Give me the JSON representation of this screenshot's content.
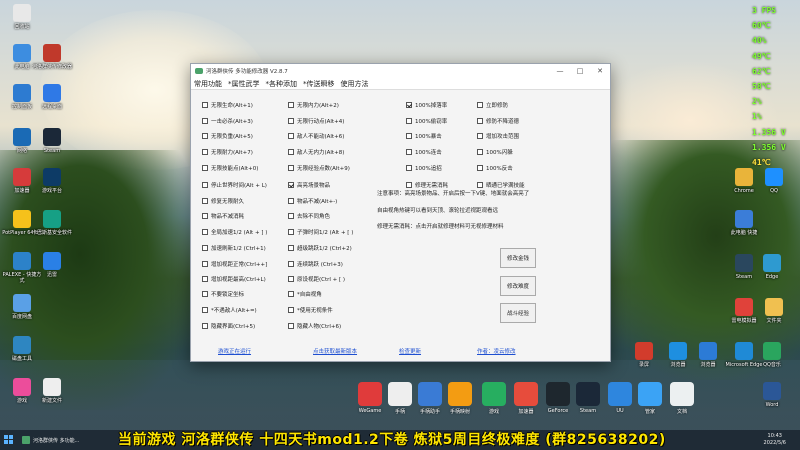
{
  "desktop_icons_left": [
    {
      "label": "回收站",
      "color": "#e8e8e8"
    },
    {
      "label": "此电脑",
      "color": "#3d8de0"
    },
    {
      "label": "河洛群侠传修改器",
      "color": "#c0392b"
    },
    {
      "label": "控制面板",
      "color": "#2d7bd1"
    },
    {
      "label": "远程桌面",
      "color": "#2f79e6"
    },
    {
      "label": "网络",
      "color": "#1a6ab5"
    },
    {
      "label": "Steam",
      "color": "#1b2838"
    },
    {
      "label": "游戏平台",
      "color": "#0d3b66"
    },
    {
      "label": "加速器",
      "color": "#d63b3b"
    },
    {
      "label": "PotPlayer 64 bit",
      "color": "#f5c11b"
    },
    {
      "label": "卡巴斯基安全软件",
      "color": "#16a085"
    },
    {
      "label": "PALEXE - 快捷方式",
      "color": "#2c82c9"
    },
    {
      "label": "迅雷",
      "color": "#2a80e6"
    },
    {
      "label": "百度网盘",
      "color": "#5aa0e6"
    },
    {
      "label": "磁盘工具",
      "color": "#2e86c1"
    },
    {
      "label": "游戏",
      "color": "#ec4d9b"
    },
    {
      "label": "新建文件",
      "color": "#eeeeee"
    }
  ],
  "hud": [
    {
      "text": "3 FPS",
      "yellow": false
    },
    {
      "text": "60℃",
      "yellow": false
    },
    {
      "text": "40%",
      "yellow": false
    },
    {
      "text": "49℃",
      "yellow": false
    },
    {
      "text": "62℃",
      "yellow": false
    },
    {
      "text": "58℃",
      "yellow": false
    },
    {
      "text": "2%",
      "yellow": false
    },
    {
      "text": "1%",
      "yellow": false
    },
    {
      "text": "1.356 V",
      "yellow": false
    },
    {
      "text": "1.356 V",
      "yellow": false
    },
    {
      "text": "41℃",
      "yellow": true
    }
  ],
  "window": {
    "title": "河洛群侠传 多功能修改器  V2.8.7",
    "minimize": "—",
    "maximize": "□",
    "close": "✕",
    "menus": [
      "常用功能",
      "*属性武学",
      "*各种添加",
      "*传送瞬移",
      "使用方法"
    ],
    "col1": [
      {
        "label": "无限生命(Alt+1)",
        "checked": false
      },
      {
        "label": "一击必杀(Alt+3)",
        "checked": false
      },
      {
        "label": "无限负重(Alt+5)",
        "checked": false
      },
      {
        "label": "无限耐力(Alt+7)",
        "checked": false
      },
      {
        "label": "无限技能点(Alt+0)",
        "checked": false
      },
      {
        "label": "停止世界时间(Alt + L)",
        "checked": false
      },
      {
        "label": "修复无限耐久",
        "checked": false
      },
      {
        "label": "物品不减消耗",
        "checked": false
      },
      {
        "label": "全局加速1/2 (Alt + ] )",
        "checked": false
      },
      {
        "label": "加速刷新1/2 (Ctrl+1)",
        "checked": false
      },
      {
        "label": "增加视距正常(Ctrl++]",
        "checked": false
      },
      {
        "label": "增加视距最高(Ctrl+L)",
        "checked": false
      },
      {
        "label": "不要锁定坐标",
        "checked": false
      },
      {
        "label": "*不遇敌人(Alt+=)",
        "checked": false
      },
      {
        "label": "隐藏界面(Ctrl+5)",
        "checked": false
      }
    ],
    "col2": [
      {
        "label": "无限内力(Alt+2)",
        "checked": false
      },
      {
        "label": "无限行动点(Alt+4)",
        "checked": false
      },
      {
        "label": "敌人不能动(Alt+6)",
        "checked": false
      },
      {
        "label": "敌人无内力(Alt+8)",
        "checked": false
      },
      {
        "label": "无限经验点数(Alt+9)",
        "checked": false
      },
      {
        "label": "高亮场景物品",
        "checked": true
      },
      {
        "label": "物品不减(Alt+-)",
        "checked": false
      },
      {
        "label": "去除不同角色",
        "checked": false
      },
      {
        "label": "子弹时间1/2 (Alt + [ )",
        "checked": false
      },
      {
        "label": "超级跳跃1/2 (Ctrl+2)",
        "checked": false
      },
      {
        "label": "连续跳跃 (Ctrl+3)",
        "checked": false
      },
      {
        "label": "原设视距(Ctrl + [ )",
        "checked": false
      },
      {
        "label": "*自由视角",
        "checked": false
      },
      {
        "label": "*使用无视条件",
        "checked": false
      },
      {
        "label": "隐藏人物(Ctrl+6)",
        "checked": false
      }
    ],
    "col3": [
      {
        "label": "100%掉落率",
        "checked": true
      },
      {
        "label": "100%偷窃率",
        "checked": false
      },
      {
        "label": "100%暴击",
        "checked": false
      },
      {
        "label": "100%连击",
        "checked": false
      },
      {
        "label": "100%追招",
        "checked": false
      },
      {
        "label": "修理无需消耗",
        "checked": false
      }
    ],
    "col4": [
      {
        "label": "立即修防",
        "checked": false
      },
      {
        "label": "修防不降道德",
        "checked": false
      },
      {
        "label": "增加攻击范围",
        "checked": false
      },
      {
        "label": "100%闪躲",
        "checked": false
      },
      {
        "label": "100%反击",
        "checked": false
      },
      {
        "label": "晒通已学满技能",
        "checked": false
      }
    ],
    "notes": [
      "注意事项：高亮场景物品、开启后按一下V键、地面就会高亮了",
      "自由视角热键可以看到天顶、滚轮拉近视距观看远",
      "修理无需消耗：点击开启就修理材料可无视修理材料"
    ],
    "buttons": [
      "修改金钱",
      "修改难度",
      "战斗经验"
    ],
    "links": [
      "游戏正在运行",
      "点击获取最新版本",
      "检查更新",
      "作者：凌云修改"
    ]
  },
  "right_icons": [
    {
      "label": "Chrome",
      "color": "#e9b43a"
    },
    {
      "label": "QQ",
      "color": "#1e90ff"
    },
    {
      "label": "此电脑 快捷",
      "color": "#3b7dd8"
    },
    {
      "label": "Steam",
      "color": "#2a475e"
    },
    {
      "label": "雷电模拟器",
      "color": "#e0423a"
    },
    {
      "label": "文件夹",
      "color": "#f0c050"
    },
    {
      "label": "Edge",
      "color": "#2e9ad0"
    },
    {
      "label": "录屏",
      "color": "#d23c2c"
    },
    {
      "label": "浏览器",
      "color": "#1e8fe0"
    },
    {
      "label": "浏览器",
      "color": "#2c7bd6"
    },
    {
      "label": "Microsoft Edge",
      "color": "#1f8ad6"
    },
    {
      "label": "QQ音乐",
      "color": "#2aa55e"
    },
    {
      "label": "Word",
      "color": "#2b5797"
    }
  ],
  "shelf": [
    {
      "label": "WeGame",
      "color": "#e03b3b"
    },
    {
      "label": "手柄",
      "color": "#eeeeee"
    },
    {
      "label": "手柄助手",
      "color": "#3a7bd5"
    },
    {
      "label": "手柄映射",
      "color": "#f39c12"
    },
    {
      "label": "游戏",
      "color": "#27ae60"
    },
    {
      "label": "加速器",
      "color": "#e74c3c"
    },
    {
      "label": "GeForce",
      "color": "#1e272e"
    },
    {
      "label": "Steam",
      "color": "#1b2838"
    },
    {
      "label": "UU",
      "color": "#2e86de"
    },
    {
      "label": "管家",
      "color": "#3ba3f5"
    },
    {
      "label": "文档",
      "color": "#ecf0f1"
    }
  ],
  "banner": "当前游戏 河洛群侠传  十四天书mod1.2下卷  炼狱5周目终极难度  (群825638202)",
  "taskbar": {
    "app": "河洛群侠传 多功能...",
    "time": "10:43",
    "date": "2022/5/6"
  }
}
